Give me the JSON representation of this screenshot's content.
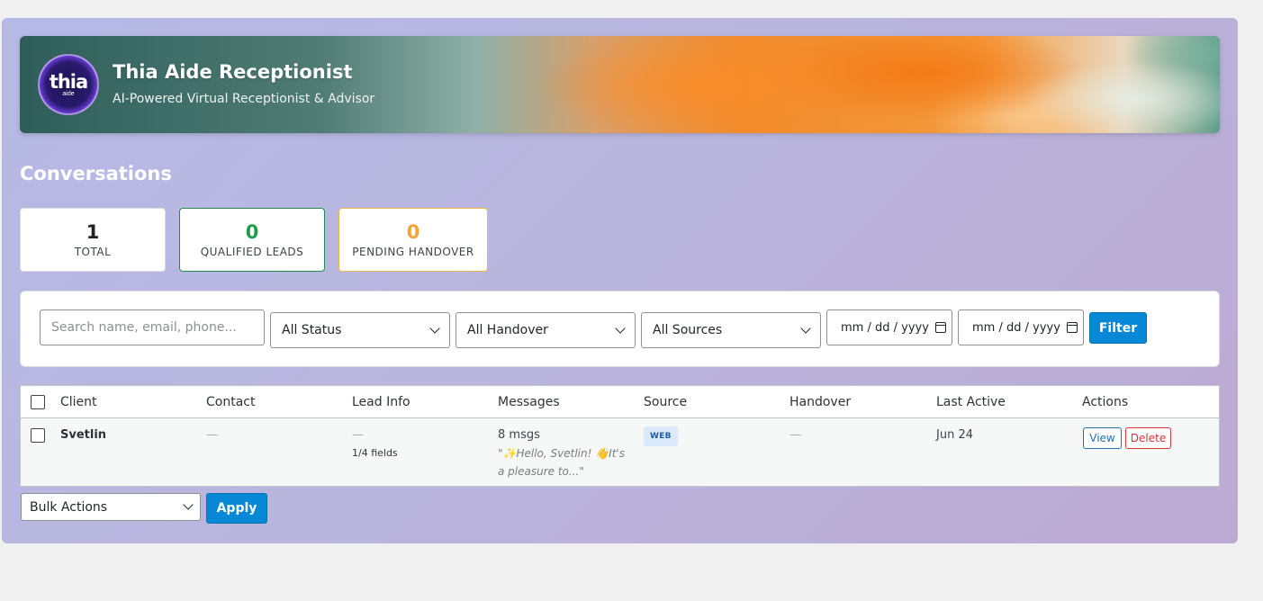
{
  "header": {
    "logo_word": "thia",
    "logo_sub": "aide",
    "title": "Thia Aide Receptionist",
    "subtitle": "AI-Powered Virtual Receptionist & Advisor"
  },
  "page_title": "Conversations",
  "stats": [
    {
      "value": "1",
      "label": "TOTAL"
    },
    {
      "value": "0",
      "label": "QUALIFIED LEADS"
    },
    {
      "value": "0",
      "label": "PENDING HANDOVER"
    }
  ],
  "filters": {
    "search_placeholder": "Search name, email, phone...",
    "status": "All Status",
    "handover": "All Handover",
    "sources": "All Sources",
    "date_from": "mm / dd / yyyy",
    "date_to": "mm / dd / yyyy",
    "filter_label": "Filter"
  },
  "table": {
    "columns": [
      "Client",
      "Contact",
      "Lead Info",
      "Messages",
      "Source",
      "Handover",
      "Last Active",
      "Actions"
    ],
    "rows": [
      {
        "client": "Svetlin",
        "contact": "—",
        "lead_info_top": "—",
        "lead_info_fields": "1/4 fields",
        "messages_count": "8 msgs",
        "messages_preview": "\"✨Hello, Svetlin! 👋It's a pleasure to...\"",
        "source": "WEB",
        "handover": "—",
        "last_active": "Jun 24",
        "view_label": "View",
        "delete_label": "Delete"
      }
    ]
  },
  "bulk": {
    "selected": "Bulk Actions",
    "apply_label": "Apply"
  },
  "colors": {
    "primary": "#0788d6",
    "qualified": "#1d9d48",
    "pending": "#f0a336",
    "delete": "#d63638"
  }
}
